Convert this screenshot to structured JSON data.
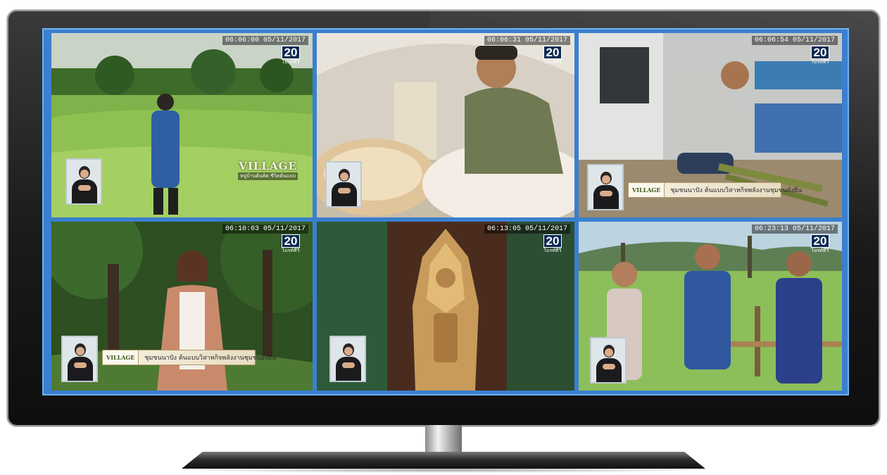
{
  "monitor": {
    "panels": [
      {
        "timestamp": "06:06:00 05/11/2017",
        "channel_number": "20",
        "channel_sub": "ไบรท์ทีวี",
        "logo_title": "VILLAGE",
        "logo_subtitle": "หมู่บ้านต้นคิด ชีวิตต้นแบบ",
        "subtitle": ""
      },
      {
        "timestamp": "06:06:31 05/11/2017",
        "channel_number": "20",
        "channel_sub": "ไบรท์ทีวี",
        "subtitle": ""
      },
      {
        "timestamp": "06:06:54 05/11/2017",
        "channel_number": "20",
        "channel_sub": "ไบรท์ทีวี",
        "lower_third_logo": "VILLAGE",
        "lower_third_text": "ชุมชนนาปัง ต้นแบบวิสาหกิจพลังงานชุมชนยั่งยืน",
        "subtitle": ""
      },
      {
        "timestamp": "06:10:03 05/11/2017",
        "channel_number": "20",
        "channel_sub": "ไบรท์ทีวี",
        "lower_third_logo": "VILLAGE",
        "lower_third_text": "ชุมชนนาปัง ต้นแบบวิสาหกิจพลังงานชุมชนยั่งยืน",
        "subtitle": ""
      },
      {
        "timestamp": "06:13:05 05/11/2017",
        "channel_number": "20",
        "channel_sub": "ไบรท์ทีวี",
        "subtitle": ""
      },
      {
        "timestamp": "06:23:13 05/11/2017",
        "channel_number": "20",
        "channel_sub": "ไบรท์ทีวี",
        "subtitle": ""
      }
    ]
  },
  "colors": {
    "screen_border": "#3a7fd0",
    "bezel": "#1a1a1b",
    "channel_logo_bg": "#0b2a52"
  }
}
